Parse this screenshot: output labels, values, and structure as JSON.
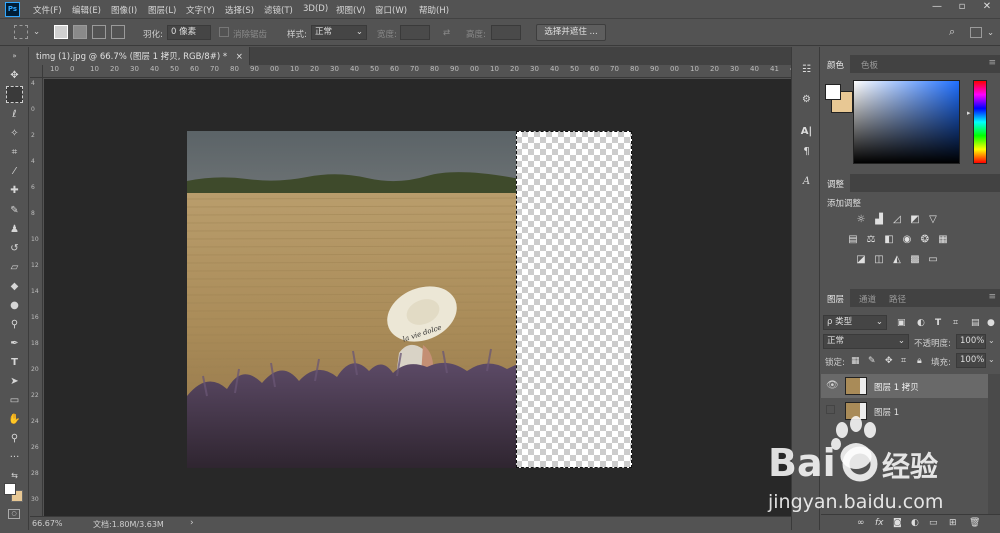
{
  "app": {
    "logo": "Ps"
  },
  "menu": [
    "文件(F)",
    "编辑(E)",
    "图像(I)",
    "图层(L)",
    "文字(Y)",
    "选择(S)",
    "滤镜(T)",
    "3D(D)",
    "视图(V)",
    "窗口(W)",
    "帮助(H)"
  ],
  "window_controls": {
    "minimize": "—",
    "restore": "▫",
    "close": "✕"
  },
  "options": {
    "feather_label": "羽化:",
    "feather_value": "0 像素",
    "antialias_label": "消除锯齿",
    "style_label": "样式:",
    "style_value": "正常",
    "width_label": "宽度:",
    "height_label": "高度:",
    "select_mask_button": "选择并遮住 ..."
  },
  "document": {
    "tab_title": "timg (1).jpg @ 66.7% (图层 1 拷贝, RGB/8#) *",
    "tab_close": "×",
    "zoom": "66.67%",
    "doc_size": "文档:1.80M/3.63M",
    "status_arrow": "›"
  },
  "ruler_top": [
    "10",
    "0",
    "10",
    "20",
    "30",
    "40",
    "50",
    "60",
    "70",
    "80",
    "90",
    "00",
    "10",
    "20",
    "30",
    "40",
    "50",
    "60",
    "70",
    "80",
    "90",
    "00",
    "10",
    "20",
    "30",
    "40",
    "50",
    "60",
    "70",
    "80",
    "90",
    "00",
    "10",
    "20",
    "30",
    "40",
    "41",
    "42"
  ],
  "ruler_left": [
    "4",
    "0",
    "2",
    "4",
    "6",
    "8",
    "10",
    "12",
    "14",
    "16",
    "18",
    "20",
    "22",
    "24",
    "26",
    "28",
    "30"
  ],
  "photo": {
    "hat_text": "la vie dolce"
  },
  "panels": {
    "color_tabs": [
      "颜色",
      "色板"
    ],
    "adjust_tab": "调整",
    "adjust_title": "添加调整",
    "layer_tabs": [
      "图层",
      "通道",
      "路径"
    ],
    "kind_label": "ρ 类型",
    "blend_mode": "正常",
    "opacity_label": "不透明度:",
    "opacity_value": "100%",
    "lock_label": "锁定:",
    "fill_label": "填充:",
    "fill_value": "100%",
    "layers": [
      {
        "name": "图层 1 拷贝",
        "visible": true,
        "selected": true
      },
      {
        "name": "图层 1",
        "visible": false,
        "selected": false
      }
    ]
  },
  "watermark": {
    "brand": "Bai",
    "brand_tail": "经验",
    "url": "jingyan.baidu.com"
  },
  "colors": {
    "accent_blue": "#31a8ff",
    "panel": "#535353",
    "canvas_bg": "#282828",
    "hue_top": "#ff0000"
  }
}
